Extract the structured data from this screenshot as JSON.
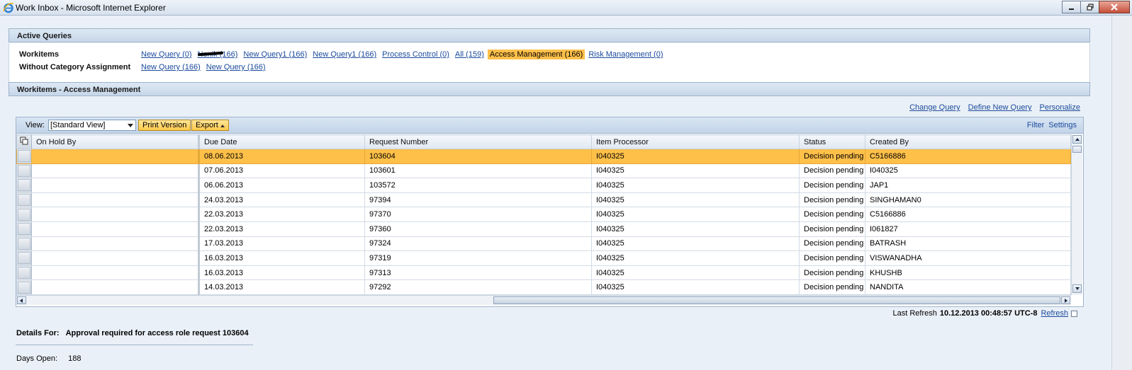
{
  "window": {
    "title": "Work Inbox - Microsoft Internet Explorer"
  },
  "active_queries": {
    "header": "Active Queries",
    "workitems_label": "Workitems",
    "workitems_links": [
      {
        "label": "New Query (0)"
      },
      {
        "label": "Nenik (166)"
      },
      {
        "label": "New Query1 (166)"
      },
      {
        "label": "New Query1 (166)"
      },
      {
        "label": "Process Control (0)"
      },
      {
        "label": "All (159)"
      },
      {
        "label": "Access Management (166)"
      },
      {
        "label": "Risk Management (0)"
      }
    ],
    "without_category_label": "Without Category Assignment",
    "without_category_links": [
      {
        "label": "New Query (166)"
      },
      {
        "label": "New Query (166)"
      }
    ]
  },
  "workitems": {
    "header": "Workitems - Access Management",
    "top_links": {
      "change_query": "Change Query",
      "define_new_query": "Define New Query",
      "personalize": "Personalize"
    },
    "toolbar": {
      "view_label": "View:",
      "view_value": "[Standard View]",
      "print_version": "Print Version",
      "export": "Export",
      "filter": "Filter",
      "settings": "Settings"
    },
    "columns": [
      "On Hold By",
      "Due Date",
      "Request Number",
      "Item Processor",
      "Status",
      "Created By"
    ],
    "rows": [
      {
        "on_hold_by": "",
        "due_date": "08.06.2013",
        "request_number": "103604",
        "item_processor": "I040325",
        "status": "Decision pending",
        "created_by": "C5166886"
      },
      {
        "on_hold_by": "",
        "due_date": "07.06.2013",
        "request_number": "103601",
        "item_processor": "I040325",
        "status": "Decision pending",
        "created_by": "I040325"
      },
      {
        "on_hold_by": "",
        "due_date": "06.06.2013",
        "request_number": "103572",
        "item_processor": "I040325",
        "status": "Decision pending",
        "created_by": "JAP1"
      },
      {
        "on_hold_by": "",
        "due_date": "24.03.2013",
        "request_number": "97394",
        "item_processor": "I040325",
        "status": "Decision pending",
        "created_by": "SINGHAMAN0"
      },
      {
        "on_hold_by": "",
        "due_date": "22.03.2013",
        "request_number": "97370",
        "item_processor": "I040325",
        "status": "Decision pending",
        "created_by": "C5166886"
      },
      {
        "on_hold_by": "",
        "due_date": "22.03.2013",
        "request_number": "97360",
        "item_processor": "I040325",
        "status": "Decision pending",
        "created_by": "I061827"
      },
      {
        "on_hold_by": "",
        "due_date": "17.03.2013",
        "request_number": "97324",
        "item_processor": "I040325",
        "status": "Decision pending",
        "created_by": "BATRASH"
      },
      {
        "on_hold_by": "",
        "due_date": "16.03.2013",
        "request_number": "97319",
        "item_processor": "I040325",
        "status": "Decision pending",
        "created_by": "VISWANADHA"
      },
      {
        "on_hold_by": "",
        "due_date": "16.03.2013",
        "request_number": "97313",
        "item_processor": "I040325",
        "status": "Decision pending",
        "created_by": "KHUSHB"
      },
      {
        "on_hold_by": "",
        "due_date": "14.03.2013",
        "request_number": "97292",
        "item_processor": "I040325",
        "status": "Decision pending",
        "created_by": "NANDITA"
      }
    ],
    "last_refresh_label": "Last Refresh",
    "last_refresh_value": "10.12.2013 00:48:57 UTC-8",
    "refresh_link": "Refresh"
  },
  "details": {
    "label": "Details For:",
    "value": "Approval required for access role request 103604",
    "days_open_label": "Days Open:",
    "days_open_value": "188"
  },
  "colors": {
    "selected_row": "#ffc04a",
    "link": "#1b4a9c",
    "header_bar": "#c7d7e9"
  }
}
